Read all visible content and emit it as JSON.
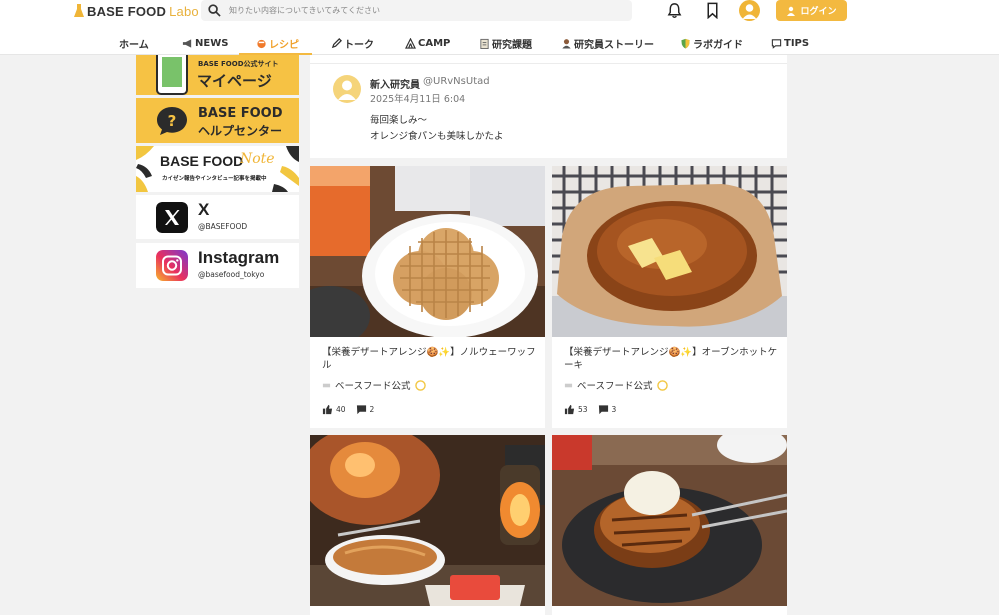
{
  "header": {
    "logo_primary": "BASE FOOD",
    "logo_secondary": "Labo",
    "search_placeholder": "知りたい内容についてきいてみてください",
    "login_label": "ログイン"
  },
  "nav": {
    "items": [
      {
        "label": "ホーム",
        "icon": "home",
        "active": false
      },
      {
        "label": "NEWS",
        "icon": "megaphone-icon",
        "active": false
      },
      {
        "label": "レシピ",
        "icon": "pot-icon",
        "active": true
      },
      {
        "label": "トーク",
        "icon": "pencil-icon",
        "active": false
      },
      {
        "label": "CAMP",
        "icon": "tent-icon",
        "active": false
      },
      {
        "label": "研究課題",
        "icon": "clipboard-icon",
        "active": false
      },
      {
        "label": "研究員ストーリー",
        "icon": "person-icon",
        "active": false
      },
      {
        "label": "ラボガイド",
        "icon": "shield-icon",
        "active": false
      },
      {
        "label": "TIPS",
        "icon": "speech-bubble-icon",
        "active": false
      }
    ]
  },
  "sidebar": {
    "mypage": {
      "small": "BASE FOOD公式サイト",
      "big": "マイページ"
    },
    "help": {
      "line1": "BASE FOOD",
      "line2": "ヘルプセンター"
    },
    "note": {
      "title": "BASE FOOD",
      "script": "Note",
      "sub": "カイゼン報告やインタビュー記事を掲載中"
    },
    "x": {
      "name": "X",
      "handle": "@BASEFOOD"
    },
    "instagram": {
      "name": "Instagram",
      "handle": "@basefood_tokyo"
    }
  },
  "comment": {
    "name": "新入研究員",
    "handle": "@URvNsUtad",
    "time": "2025年4月11日 6:04",
    "line1": "毎回楽しみ〜",
    "line2": "オレンジ食パンも美味しかたよ"
  },
  "posts": [
    {
      "title": "【栄養デザートアレンジ🍪✨】ノルウェーワッフル",
      "author": "ベースフード公式",
      "likes": "40",
      "comments": "2"
    },
    {
      "title": "【栄養デザートアレンジ🍪✨】オーブンホットケーキ",
      "author": "ベースフード公式",
      "likes": "53",
      "comments": "3"
    },
    {
      "title": "",
      "author": "",
      "likes": "",
      "comments": ""
    },
    {
      "title": "",
      "author": "",
      "likes": "",
      "comments": ""
    }
  ],
  "colors": {
    "brand": "#f3b940",
    "active_nav": "#f0a12b",
    "banner_yellow": "#f6c244"
  }
}
